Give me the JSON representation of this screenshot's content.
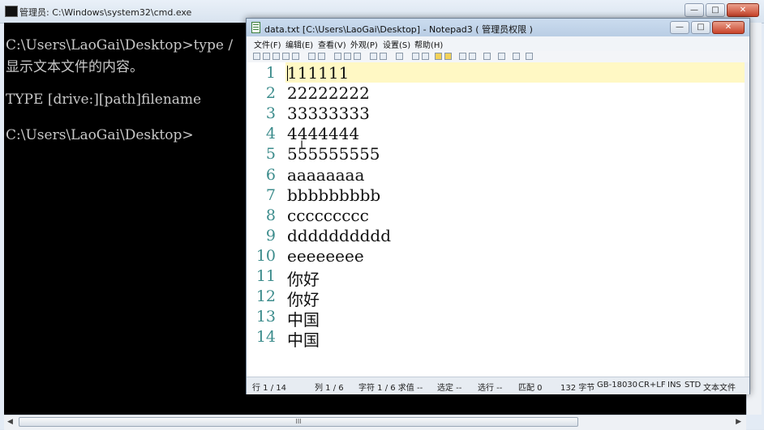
{
  "cmd": {
    "title": "管理员: C:\\Windows\\system32\\cmd.exe",
    "lines": [
      "C:\\Users\\LaoGai\\Desktop>type /",
      "显示文本文件的内容。",
      "",
      "TYPE [drive:][path]filename",
      "",
      "C:\\Users\\LaoGai\\Desktop>"
    ],
    "buttons": {
      "minimize": "—",
      "maximize": "□",
      "close": "✕"
    },
    "scroll_thumb": "III"
  },
  "notepad": {
    "title": "data.txt [C:\\Users\\LaoGai\\Desktop] - Notepad3 ( 管理员权限 )",
    "menu": [
      "文件(F)",
      "编辑(E)",
      "查看(V)",
      "外观(P)",
      "设置(S)",
      "帮助(H)"
    ],
    "buttons": {
      "minimize": "—",
      "maximize": "□",
      "close": "✕"
    },
    "lines": [
      {
        "num": "1",
        "text": "111111"
      },
      {
        "num": "2",
        "text": "22222222"
      },
      {
        "num": "3",
        "text": "33333333"
      },
      {
        "num": "4",
        "text": "4444444"
      },
      {
        "num": "5",
        "text": "555555555"
      },
      {
        "num": "6",
        "text": "aaaaaaaa"
      },
      {
        "num": "7",
        "text": "bbbbbbbbb"
      },
      {
        "num": "8",
        "text": "ccccccccc"
      },
      {
        "num": "9",
        "text": "dddddddddd"
      },
      {
        "num": "10",
        "text": "eeeeeeee"
      },
      {
        "num": "11",
        "text": "你好"
      },
      {
        "num": "12",
        "text": "你好"
      },
      {
        "num": "13",
        "text": "中国"
      },
      {
        "num": "14",
        "text": "中国"
      }
    ],
    "status": {
      "row": "行 1 / 14",
      "col": "列 1 / 6",
      "char": "字符 1 / 6 求值 --",
      "select": "选定 --",
      "select_lines": "选行 --",
      "match": "匹配 0",
      "bytes": "132 字节",
      "encoding": "GB-18030",
      "eol": "CR+LF",
      "ins": "INS",
      "std": "STD",
      "type": "文本文件"
    }
  },
  "colors": {
    "console_bg": "#000000",
    "console_text": "#c8c8c8",
    "line_number": "#3c8c8c",
    "current_line": "#fff8c4"
  }
}
